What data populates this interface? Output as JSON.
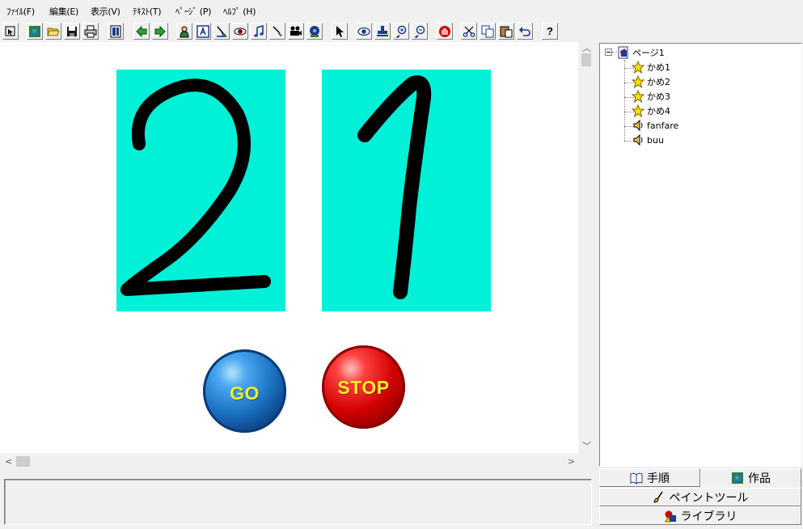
{
  "menu": {
    "file": "ﾌｧｲﾙ(F)",
    "edit": "編集(E)",
    "view": "表示(V)",
    "text": "ﾃｷｽﾄ(T)",
    "page": "ﾍﾟｰｼﾞ (P)",
    "help": "ﾍﾙﾌﾟ (H)"
  },
  "toolbar": {
    "icons": [
      "pointer-small",
      "globe",
      "open-folder",
      "save",
      "print",
      "layout",
      "arrow-left",
      "arrow-right",
      "character",
      "text-a",
      "paint",
      "eye-red",
      "music-note",
      "brush",
      "movie",
      "disc",
      "cursor",
      "eye",
      "stamp",
      "zoom-in",
      "zoom-out",
      "stop-hand",
      "cut",
      "copy",
      "paste",
      "undo",
      "help"
    ],
    "help_label": "?"
  },
  "canvas": {
    "digits": [
      "2",
      "1"
    ],
    "digit_color": "#00f0d8",
    "go_label": "GO",
    "stop_label": "STOP",
    "go_color": "#1a6fc0",
    "stop_color": "#d40000"
  },
  "tree": {
    "root": "ページ1",
    "children": [
      {
        "label": "かめ1",
        "icon": "star-character"
      },
      {
        "label": "かめ2",
        "icon": "star-character"
      },
      {
        "label": "かめ3",
        "icon": "star-character"
      },
      {
        "label": "かめ4",
        "icon": "star-character"
      },
      {
        "label": "fanfare",
        "icon": "speaker"
      },
      {
        "label": "buu",
        "icon": "speaker"
      }
    ]
  },
  "panel_tabs": {
    "procedure": "手順",
    "work": "作品",
    "paint_tool": "ペイントツール",
    "library": "ライブラリ"
  }
}
